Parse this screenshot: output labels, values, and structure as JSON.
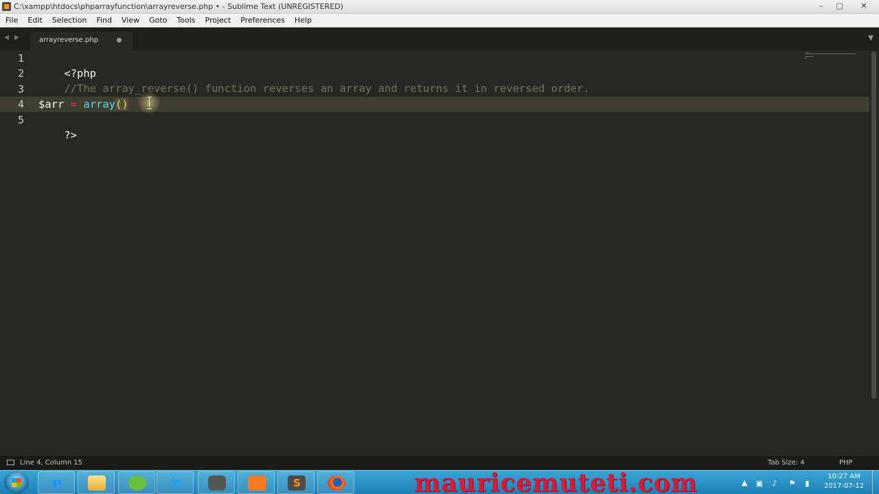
{
  "window": {
    "title": "C:\\xampp\\htdocs\\phparrayfunction\\arrayreverse.php • - Sublime Text (UNREGISTERED)",
    "controls": [
      "–",
      "□",
      "✕"
    ]
  },
  "menu": [
    "File",
    "Edit",
    "Selection",
    "Find",
    "View",
    "Goto",
    "Tools",
    "Project",
    "Preferences",
    "Help"
  ],
  "tabs": [
    {
      "label": "arrayreverse.php",
      "dirty": true
    }
  ],
  "editor": {
    "line_numbers": [
      "1",
      "2",
      "3",
      "4",
      "5"
    ],
    "lines": {
      "l1": "<?php",
      "l2": "//The array_reverse() function reverses an array and returns it in reversed order.",
      "l4_var": "$arr",
      "l4_op": "=",
      "l4_fn": "array",
      "l4_paren": "()",
      "l5": "?>"
    },
    "current_line": 4
  },
  "status": {
    "position": "Line 4, Column 15",
    "tab_size": "Tab Size: 4",
    "syntax": "PHP"
  },
  "taskbar": {
    "apps": [
      "internet-explorer",
      "file-explorer",
      "utorrent",
      "media-player",
      "tool",
      "xampp",
      "sublime-text",
      "firefox"
    ],
    "watermark": "mauricemuteti.com",
    "clock_time": "10:27 AM",
    "clock_date": "2017-07-12"
  },
  "colors": {
    "editor_bg": "#272822",
    "comment": "#75715e",
    "keyword": "#f92672",
    "function": "#66d9ef",
    "string": "#e6db74",
    "taskbar": "#2a92c7",
    "watermark": "#d41b3c"
  }
}
